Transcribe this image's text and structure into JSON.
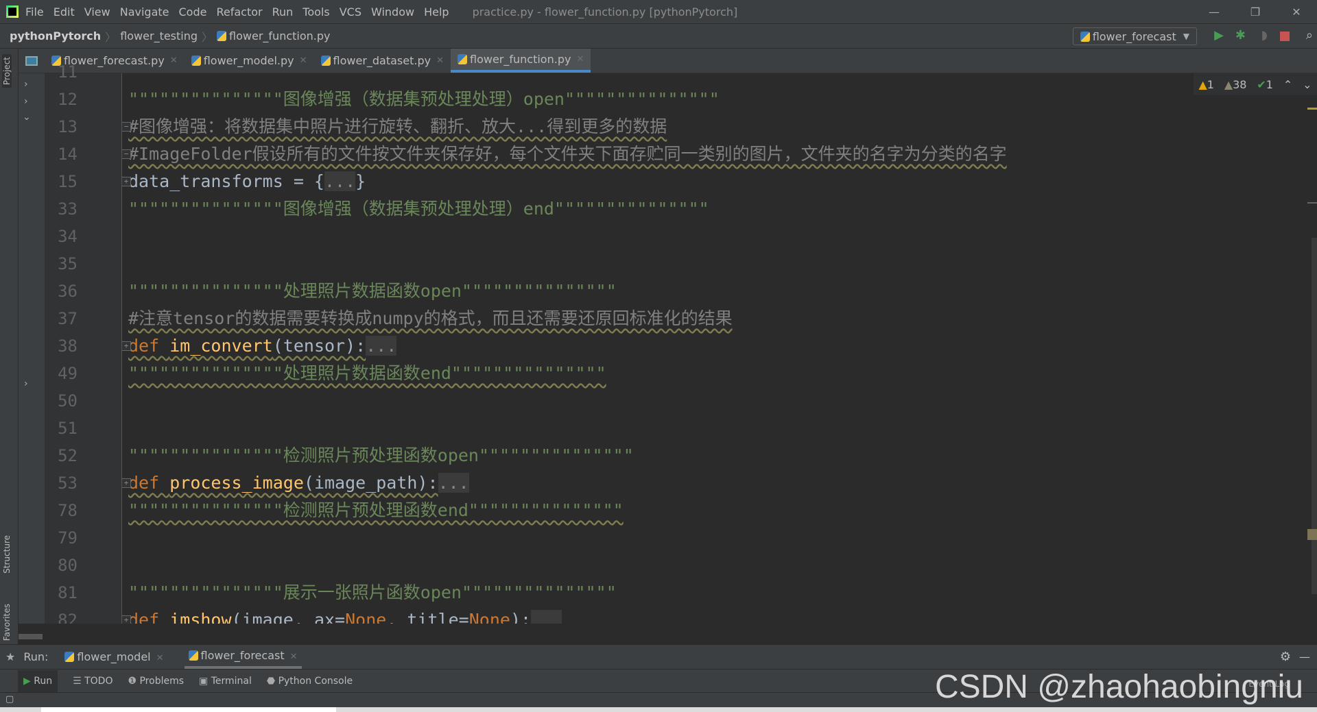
{
  "titlebar": {
    "menu": [
      "File",
      "Edit",
      "View",
      "Navigate",
      "Code",
      "Refactor",
      "Run",
      "Tools",
      "VCS",
      "Window",
      "Help"
    ],
    "title": "practice.py - flower_function.py [pythonPytorch]"
  },
  "navbar": {
    "crumbs": [
      "pythonPytorch",
      "flower_testing",
      "flower_function.py"
    ],
    "run_config": "flower_forecast"
  },
  "tabs": [
    {
      "label": "flower_forecast.py",
      "active": false
    },
    {
      "label": "flower_model.py",
      "active": false
    },
    {
      "label": "flower_dataset.py",
      "active": false
    },
    {
      "label": "flower_function.py",
      "active": true
    }
  ],
  "left_stripe": {
    "project": "Project",
    "structure": "Structure",
    "favorites": "Favorites"
  },
  "inspections": {
    "errors": "1",
    "warnings": "38",
    "typos": "1"
  },
  "colors": {
    "string": "#6a8759",
    "comment": "#808080",
    "keyword": "#cc7832",
    "function": "#ffc66d",
    "accent": "#4a88c7"
  },
  "code": [
    {
      "n": "11",
      "parts": []
    },
    {
      "n": "12",
      "parts": [
        {
          "c": "str",
          "t": "\"\"\"\"\"\"\"\"\"\"\"\"\"\"\"图像增强（数据集预处理处理）open\"\"\"\"\"\"\"\"\"\"\"\"\"\"\""
        }
      ]
    },
    {
      "n": "13",
      "fold": "−",
      "parts": [
        {
          "c": "cmt wavy",
          "t": "#图像增强：将数据集中照片进行旋转、翻折、放大...得到更多的数据"
        }
      ]
    },
    {
      "n": "14",
      "fold": "−",
      "parts": [
        {
          "c": "cmt wavy",
          "t": "#ImageFolder假设所有的文件按文件夹保存好，每个文件夹下面存贮同一类别的图片，文件夹的名字为分类的名字"
        }
      ]
    },
    {
      "n": "15",
      "fold": "+",
      "parts": [
        {
          "c": "id",
          "t": "data_transforms = {"
        },
        {
          "c": "fold",
          "t": "..."
        },
        {
          "c": "id",
          "t": "}"
        }
      ]
    },
    {
      "n": "33",
      "parts": [
        {
          "c": "str",
          "t": "\"\"\"\"\"\"\"\"\"\"\"\"\"\"\"图像增强（数据集预处理处理）end\"\"\"\"\"\"\"\"\"\"\"\"\"\"\""
        }
      ]
    },
    {
      "n": "34",
      "parts": []
    },
    {
      "n": "35",
      "parts": []
    },
    {
      "n": "36",
      "parts": [
        {
          "c": "str",
          "t": "\"\"\"\"\"\"\"\"\"\"\"\"\"\"\"处理照片数据函数open\"\"\"\"\"\"\"\"\"\"\"\"\"\"\""
        }
      ]
    },
    {
      "n": "37",
      "parts": [
        {
          "c": "cmt wavy",
          "t": "#注意tensor的数据需要转换成numpy的格式，而且还需要还原回标准化的结果"
        }
      ]
    },
    {
      "n": "38",
      "fold": "+",
      "parts": [
        {
          "c": "kw wavy",
          "t": "def "
        },
        {
          "c": "fn wavy",
          "t": "im_convert"
        },
        {
          "c": "id wavy",
          "t": "(tensor):"
        },
        {
          "c": "fold",
          "t": "..."
        }
      ]
    },
    {
      "n": "49",
      "parts": [
        {
          "c": "str wavy",
          "t": "\"\"\"\"\"\"\"\"\"\"\"\"\"\"\"处理照片数据函数end\"\"\"\"\"\"\"\"\"\"\"\"\"\"\""
        }
      ]
    },
    {
      "n": "50",
      "parts": []
    },
    {
      "n": "51",
      "parts": []
    },
    {
      "n": "52",
      "parts": [
        {
          "c": "str",
          "t": "\"\"\"\"\"\"\"\"\"\"\"\"\"\"\"检测照片预处理函数open\"\"\"\"\"\"\"\"\"\"\"\"\"\"\""
        }
      ]
    },
    {
      "n": "53",
      "fold": "+",
      "parts": [
        {
          "c": "kw wavy",
          "t": "def "
        },
        {
          "c": "fn wavy",
          "t": "process_image"
        },
        {
          "c": "id wavy",
          "t": "(image_path):"
        },
        {
          "c": "fold",
          "t": "..."
        }
      ]
    },
    {
      "n": "78",
      "parts": [
        {
          "c": "str wavy",
          "t": "\"\"\"\"\"\"\"\"\"\"\"\"\"\"\"检测照片预处理函数end\"\"\"\"\"\"\"\"\"\"\"\"\"\"\""
        }
      ]
    },
    {
      "n": "79",
      "parts": []
    },
    {
      "n": "80",
      "parts": []
    },
    {
      "n": "81",
      "parts": [
        {
          "c": "str",
          "t": "\"\"\"\"\"\"\"\"\"\"\"\"\"\"\"展示一张照片函数open\"\"\"\"\"\"\"\"\"\"\"\"\"\"\""
        }
      ]
    },
    {
      "n": "82",
      "fold": "+",
      "parts": [
        {
          "c": "kw",
          "t": "def "
        },
        {
          "c": "fn",
          "t": "imshow"
        },
        {
          "c": "id",
          "t": "(image, ax="
        },
        {
          "c": "kw",
          "t": "None"
        },
        {
          "c": "id",
          "t": ", title="
        },
        {
          "c": "kw",
          "t": "None"
        },
        {
          "c": "id",
          "t": "):"
        },
        {
          "c": "fold",
          "t": "   "
        }
      ]
    }
  ],
  "run": {
    "label": "Run:",
    "tabs": [
      "flower_model",
      "flower_forecast"
    ]
  },
  "toolwindows": [
    "Run",
    "TODO",
    "Problems",
    "Terminal",
    "Python Console"
  ],
  "status": {
    "event_log": "Event Log"
  },
  "watermark": "CSDN @zhaohaobingniu"
}
